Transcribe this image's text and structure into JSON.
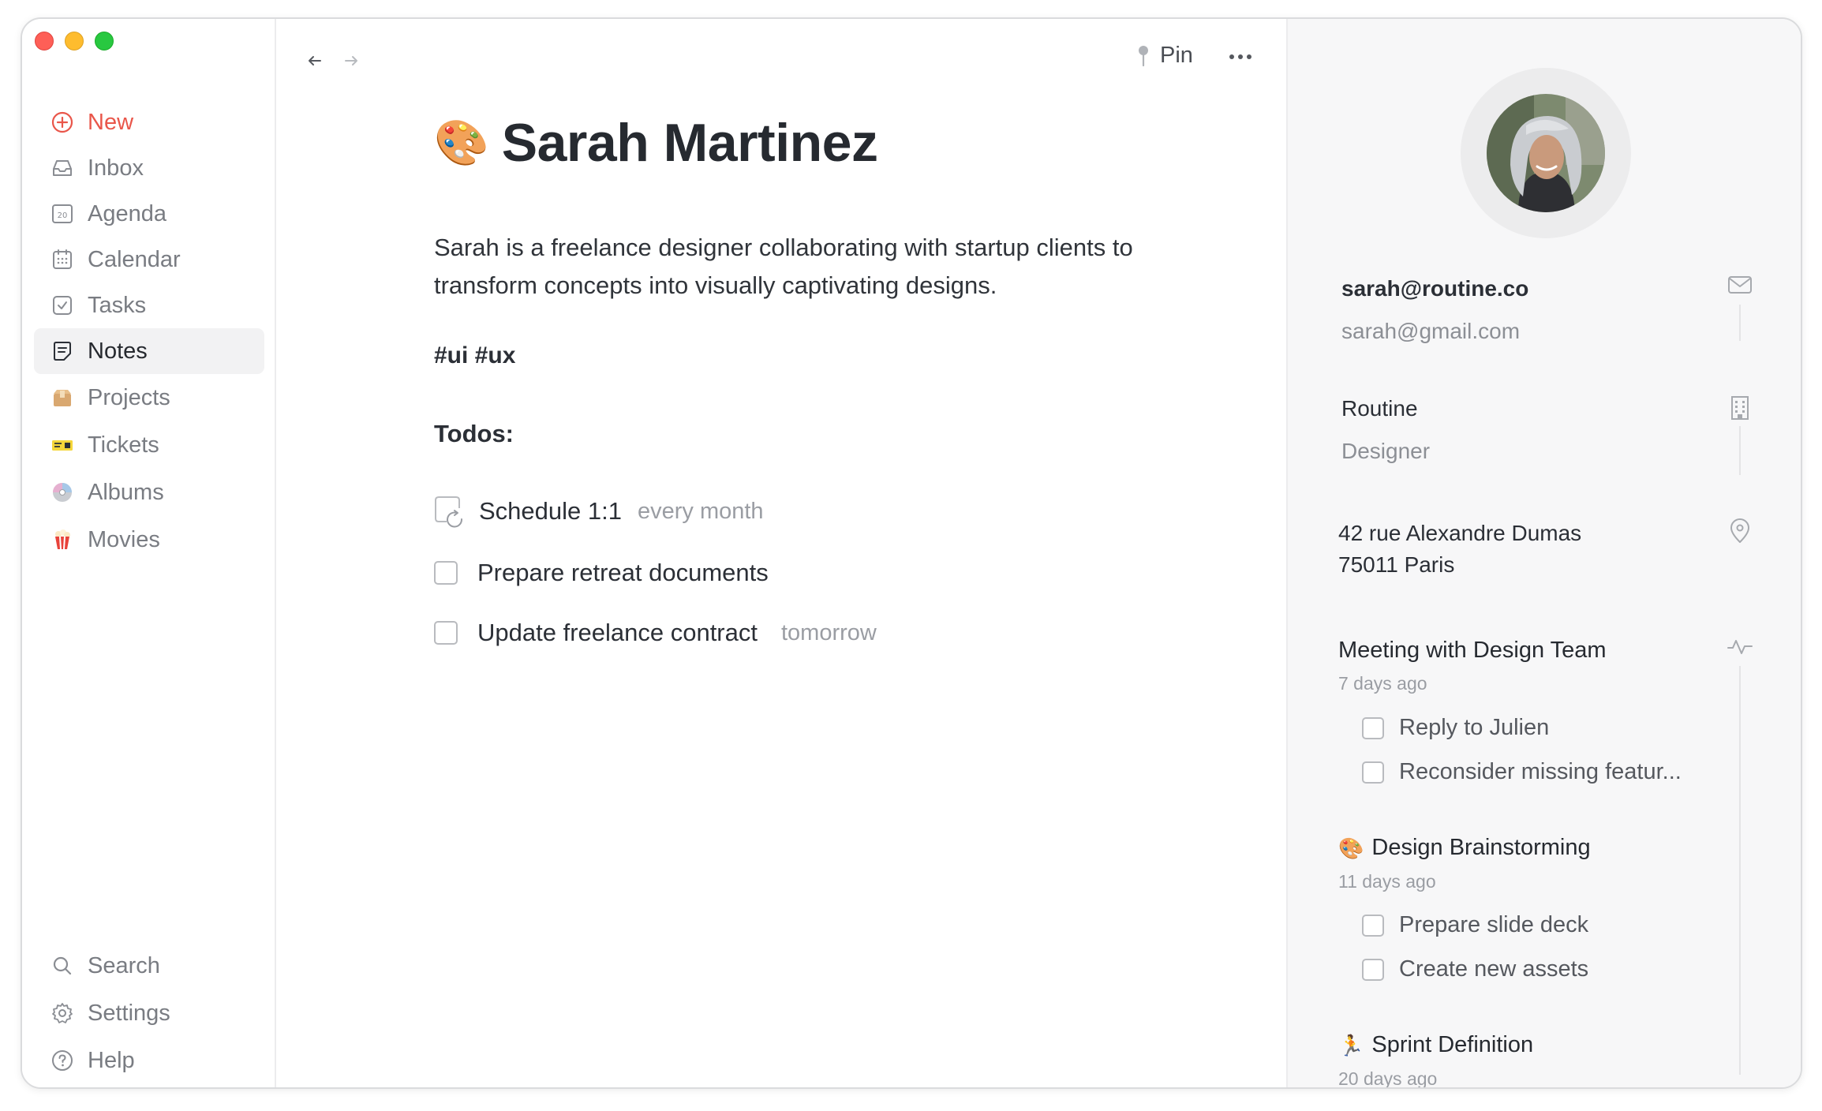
{
  "sidebar": {
    "items": [
      {
        "label": "New"
      },
      {
        "label": "Inbox"
      },
      {
        "label": "Agenda",
        "icon_text": "20"
      },
      {
        "label": "Calendar"
      },
      {
        "label": "Tasks"
      },
      {
        "label": "Notes"
      },
      {
        "label": "Projects"
      },
      {
        "label": "Tickets"
      },
      {
        "label": "Albums"
      },
      {
        "label": "Movies"
      }
    ],
    "bottom": [
      {
        "label": "Search"
      },
      {
        "label": "Settings"
      },
      {
        "label": "Help"
      }
    ],
    "active": "Notes"
  },
  "toolbar": {
    "pin_label": "Pin"
  },
  "note": {
    "emoji": "🎨",
    "title": "Sarah Martinez",
    "description": "Sarah is a freelance designer collaborating with startup clients to transform concepts into visually captivating designs.",
    "tags": "#ui #ux",
    "todos_heading": "Todos:",
    "todos": [
      {
        "text": "Schedule 1:1",
        "meta": "every month",
        "repeat": true
      },
      {
        "text": "Prepare retreat documents",
        "meta": ""
      },
      {
        "text": "Update freelance contract",
        "meta": "tomorrow"
      }
    ]
  },
  "contact": {
    "email_primary": "sarah@routine.co",
    "email_secondary": "sarah@gmail.com",
    "company": "Routine",
    "role": "Designer",
    "address_line1": "42 rue Alexandre Dumas",
    "address_line2": "75011 Paris"
  },
  "activity": [
    {
      "title": "Meeting with Design Team",
      "emoji": "",
      "time": "7 days ago",
      "todos": [
        "Reply to Julien",
        "Reconsider missing featur..."
      ]
    },
    {
      "title": "Design Brainstorming",
      "emoji": "🎨",
      "time": "11 days ago",
      "todos": [
        "Prepare slide deck",
        "Create new assets"
      ]
    },
    {
      "title": "Sprint Definition",
      "emoji": "🏃",
      "time": "20 days ago",
      "todos": []
    }
  ],
  "colors": {
    "accent_new": "#e9564a",
    "active_bg": "#f2f2f3",
    "panel_bg": "#f7f7f8",
    "traffic_red": "#fe5f57",
    "traffic_yellow": "#febc2e",
    "traffic_green": "#28c840"
  }
}
